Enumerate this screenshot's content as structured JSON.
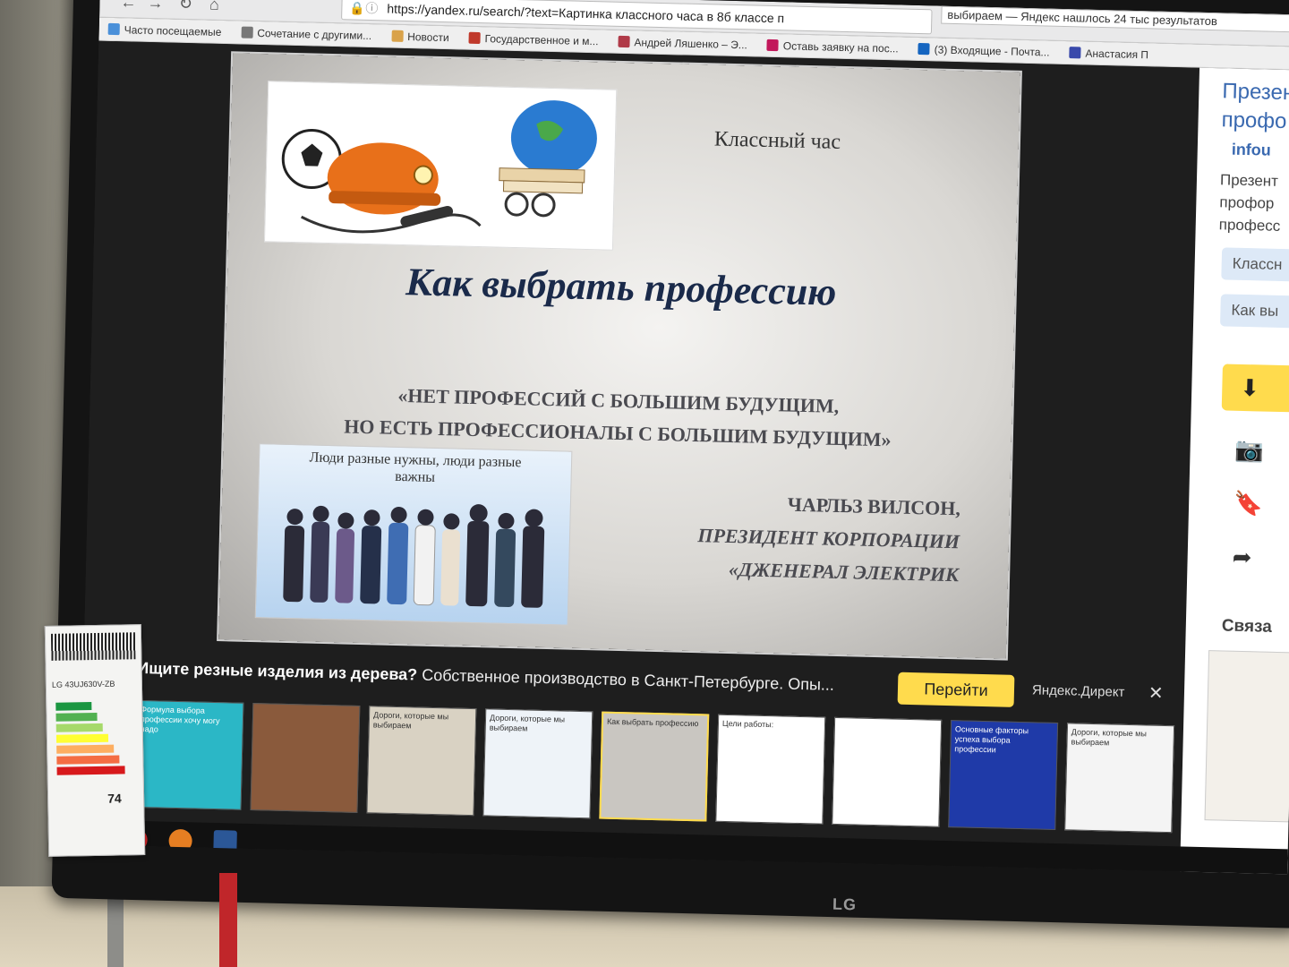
{
  "browser": {
    "url": "https://yandex.ru/search/?text=Картинка классного часа в 8б классе п",
    "tab_title": "выбираем — Яндекс нашлось 24 тыс результатов",
    "bookmarks": [
      {
        "label": "Часто посещаемые",
        "color": "#4a90d9"
      },
      {
        "label": "Сочетание с другими...",
        "color": "#777777"
      },
      {
        "label": "Новости",
        "color": "#d9a24a"
      },
      {
        "label": "Государственное и м...",
        "color": "#c0392b"
      },
      {
        "label": "Андрей Ляшенко – Э...",
        "color": "#b03a48"
      },
      {
        "label": "Оставь заявку на пос...",
        "color": "#c2185b"
      },
      {
        "label": "(3) Входящие - Почта...",
        "color": "#1565c0"
      },
      {
        "label": "Анастасия П",
        "color": "#3949ab"
      }
    ]
  },
  "slide": {
    "label": "Классный час",
    "title": "Как выбрать профессию",
    "quote_line1": "«НЕТ ПРОФЕССИЙ С БОЛЬШИМ БУДУЩИМ,",
    "quote_line2": "НО ЕСТЬ ПРОФЕССИОНАЛЫ С БОЛЬШИМ БУДУЩИМ»",
    "image_caption": "Люди разные нужны, люди разные важны",
    "author_line1": "ЧАРЛЬЗ ВИЛСОН,",
    "author_line2": "ПРЕЗИДЕНТ КОРПОРАЦИИ",
    "author_line3": "«ДЖЕНЕРАЛ ЭЛЕКТРИК"
  },
  "side_panel": {
    "title": "Презен профо",
    "source": "infou",
    "description": "Презент профор професс",
    "chip1": "Классн",
    "chip2": "Как вы",
    "download_icon": "download-icon",
    "related": "Связа"
  },
  "ad": {
    "question": "Ищите резные изделия из дерева?",
    "text": "Собственное производство в Санкт-Петербурге. Опы...",
    "button": "Перейти",
    "network": "Яндекс.Директ"
  },
  "thumbnails": [
    {
      "caption": "Формула выбора профессии хочу могу надо",
      "bg": "#2bb7c6"
    },
    {
      "caption": "",
      "bg": "#8a5a3c"
    },
    {
      "caption": "Дороги, которые мы выбираем",
      "bg": "#d9d2c3"
    },
    {
      "caption": "Дороги, которые мы выбираем",
      "bg": "#eef3f8"
    },
    {
      "caption": "Как выбрать профессию",
      "bg": "#c9c6c1"
    },
    {
      "caption": "Цели работы:",
      "bg": "#ffffff"
    },
    {
      "caption": "",
      "bg": "#ffffff"
    },
    {
      "caption": "Основные факторы успеха выбора профессии",
      "bg": "#1f3aa8"
    },
    {
      "caption": "Дороги, которые мы выбираем",
      "bg": "#f4f4f4"
    }
  ],
  "sticker": {
    "model": "LG 43UJ630V-ZB",
    "kwh": "74"
  },
  "tv_brand": "LG"
}
